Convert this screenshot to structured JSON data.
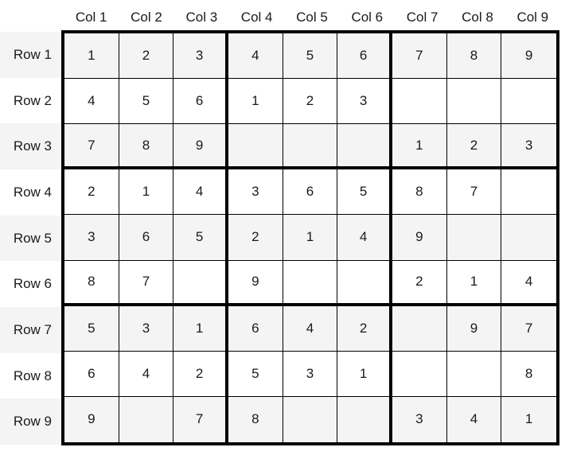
{
  "sudoku": {
    "column_headers": [
      "Col 1",
      "Col 2",
      "Col 3",
      "Col 4",
      "Col 5",
      "Col 6",
      "Col 7",
      "Col 8",
      "Col 9"
    ],
    "row_headers": [
      "Row 1",
      "Row 2",
      "Row 3",
      "Row 4",
      "Row 5",
      "Row 6",
      "Row 7",
      "Row 8",
      "Row 9"
    ],
    "grid": [
      [
        "1",
        "2",
        "3",
        "4",
        "5",
        "6",
        "7",
        "8",
        "9"
      ],
      [
        "4",
        "5",
        "6",
        "1",
        "2",
        "3",
        "",
        "",
        ""
      ],
      [
        "7",
        "8",
        "9",
        "",
        "",
        "",
        "1",
        "2",
        "3"
      ],
      [
        "2",
        "1",
        "4",
        "3",
        "6",
        "5",
        "8",
        "7",
        ""
      ],
      [
        "3",
        "6",
        "5",
        "2",
        "1",
        "4",
        "9",
        "",
        ""
      ],
      [
        "8",
        "7",
        "",
        "9",
        "",
        "",
        "2",
        "1",
        "4"
      ],
      [
        "5",
        "3",
        "1",
        "6",
        "4",
        "2",
        "",
        "9",
        "7"
      ],
      [
        "6",
        "4",
        "2",
        "5",
        "3",
        "1",
        "",
        "",
        "8"
      ],
      [
        "9",
        "",
        "7",
        "8",
        "",
        "",
        "3",
        "4",
        "1"
      ]
    ]
  },
  "colors": {
    "stripe": "#f4f4f4",
    "background": "#ffffff",
    "border": "#000000"
  }
}
